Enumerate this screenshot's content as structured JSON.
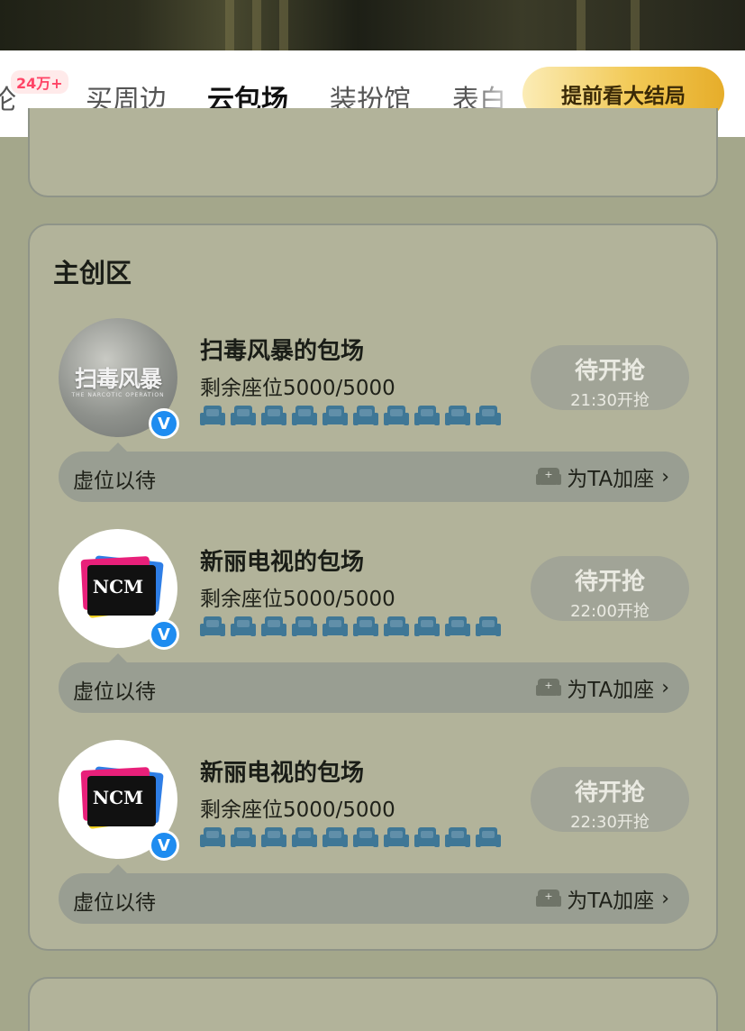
{
  "tabs": [
    {
      "label": "论",
      "badge": "24万+"
    },
    {
      "label": "买周边"
    },
    {
      "label": "云包场",
      "active": true
    },
    {
      "label": "装扮馆"
    },
    {
      "label": "表白"
    }
  ],
  "cta_label": "提前看大结局",
  "section_title": "主创区",
  "rooms": [
    {
      "avatar": "扫毒风暴",
      "avatar_sub": "THE NARCOTIC OPERATION",
      "name": "扫毒风暴的包场",
      "seats": "剩余座位5000/5000",
      "button": "待开抢",
      "time": "21:30开抢",
      "empty_text": "虚位以待",
      "add_text": "为TA加座"
    },
    {
      "avatar": "NCM",
      "name": "新丽电视的包场",
      "seats": "剩余座位5000/5000",
      "button": "待开抢",
      "time": "22:00开抢",
      "empty_text": "虚位以待",
      "add_text": "为TA加座"
    },
    {
      "avatar": "NCM",
      "name": "新丽电视的包场",
      "seats": "剩余座位5000/5000",
      "button": "待开抢",
      "time": "22:30开抢",
      "empty_text": "虚位以待",
      "add_text": "为TA加座"
    }
  ],
  "icons": {
    "sofa": "sofa-icon",
    "verified": "verified-v-icon",
    "add_seat": "add-seat-icon",
    "chevron": "chevron-right-icon"
  },
  "colors": {
    "accent_gold": "#f2c955",
    "sofa_blue": "#3f7796",
    "verified_blue": "#1e8cf0",
    "badge_red": "#ff4466"
  }
}
